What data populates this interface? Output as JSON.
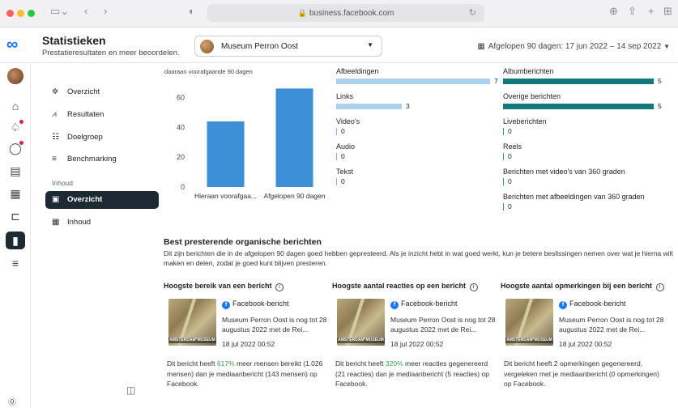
{
  "browser": {
    "url": "business.facebook.com",
    "icons": [
      "sidebar-toggle-icon",
      "back-icon",
      "forward-icon",
      "shield-icon",
      "reload-icon",
      "download-icon",
      "share-icon",
      "new-tab-icon",
      "tabs-overview-icon"
    ]
  },
  "header": {
    "title": "Statistieken",
    "subtitle": "Prestatieresultaten en meer beoordelen.",
    "account_name": "Museum Perron Oost",
    "date_range": "Afgelopen 90 dagen: 17 jun 2022 – 14 sep 2022"
  },
  "sidebar": {
    "items": [
      {
        "label": "Overzicht",
        "icon": "overview-icon",
        "active": false
      },
      {
        "label": "Resultaten",
        "icon": "results-icon",
        "active": false
      },
      {
        "label": "Doelgroep",
        "icon": "audience-icon",
        "active": false
      },
      {
        "label": "Benchmarking",
        "icon": "benchmark-icon",
        "active": false
      }
    ],
    "section_label": "Inhoud",
    "content_items": [
      {
        "label": "Overzicht",
        "icon": "content-overview-icon",
        "active": true
      },
      {
        "label": "Inhoud",
        "icon": "content-table-icon",
        "active": false
      }
    ]
  },
  "chart_data": {
    "type": "bar",
    "categories": [
      "Hieraan voorafgaa...",
      "Afgelopen 90 dagen"
    ],
    "values": [
      44,
      66
    ],
    "ylim": [
      0,
      70
    ],
    "yticks": [
      0,
      20,
      40,
      60
    ],
    "color": "#3d8fd6",
    "caption": "daaraan voorafgaande 90 dagen"
  },
  "content_types_left": [
    {
      "label": "Afbeeldingen",
      "value": 7
    },
    {
      "label": "Links",
      "value": 3
    },
    {
      "label": "Video's",
      "value": 0
    },
    {
      "label": "Audio",
      "value": 0
    },
    {
      "label": "Tekst",
      "value": 0
    }
  ],
  "content_types_right": [
    {
      "label": "Albumberichten",
      "value": 5
    },
    {
      "label": "Overige berichten",
      "value": 5
    },
    {
      "label": "Liveberichten",
      "value": 0
    },
    {
      "label": "Reels",
      "value": 0
    },
    {
      "label": "Berichten met video's van 360 graden",
      "value": 0
    },
    {
      "label": "Berichten met afbeeldingen van 360 graden",
      "value": 0
    }
  ],
  "colors": {
    "left_bar": "#a8d2ef",
    "right_bar": "#117a7a",
    "zero_tick_left": "#7fb6dd",
    "zero_tick_right": "#31a24c",
    "accent": "#1877f2",
    "highlight_green": "#31a24c"
  },
  "best": {
    "title": "Best presterende organische berichten",
    "description": "Dit zijn berichten die in de afgelopen 90 dagen goed hebben gepresteerd. Als je inzicht hebt in wat goed werkt, kun je betere beslissingen nemen over wat je hierna wilt maken en delen, zodat je goed kunt blijven presteren.",
    "source_label": "Facebook-bericht",
    "post_text": "Museum Perron Oost is nog tot 28 augustus 2022 met de Rei...",
    "post_date": "18 jul 2022 00:52",
    "thumb_caption": "AMSTERDAM*MUSEUM",
    "cards": [
      {
        "title": "Hoogste bereik van een bericht",
        "sum_pre": "Dit bericht heeft ",
        "sum_hl": "617%",
        "sum_post": " meer mensen bereikt (1.026 mensen) dan je mediaanbericht (143 mensen) op Facebook."
      },
      {
        "title": "Hoogste aantal reacties op een bericht",
        "sum_pre": "Dit bericht heeft ",
        "sum_hl": "320%",
        "sum_post": " meer reacties gegenereerd (21 reacties) dan je mediaanbericht (5 reacties) op Facebook."
      },
      {
        "title": "Hoogste aantal opmerkingen bij een bericht",
        "sum_pre": "Dit bericht heeft 2 opmerkingen gegenereerd, vergeleken met je mediaanbericht (0 opmerkingen) op Facebook.",
        "sum_hl": "",
        "sum_post": ""
      }
    ]
  }
}
